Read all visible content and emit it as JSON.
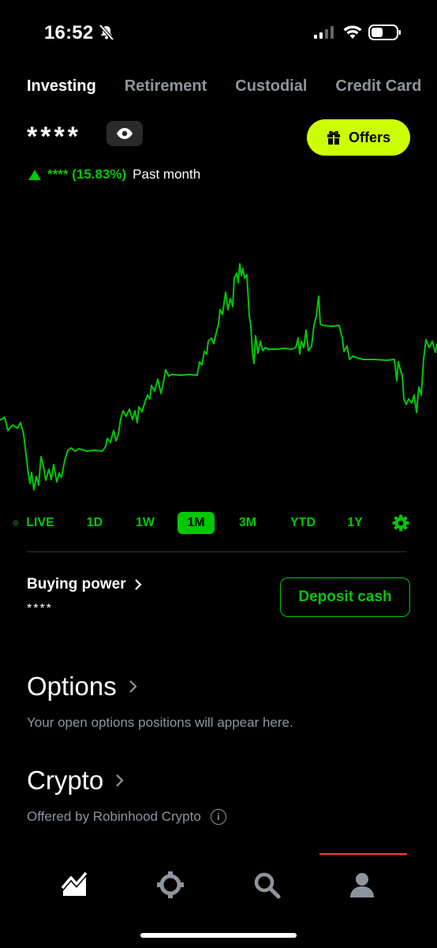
{
  "status_bar": {
    "time": "16:52"
  },
  "tabs": [
    {
      "label": "Investing",
      "active": true
    },
    {
      "label": "Retirement",
      "active": false
    },
    {
      "label": "Custodial",
      "active": false
    },
    {
      "label": "Credit Card",
      "active": false
    }
  ],
  "balance": {
    "value": "****",
    "eye_icon": "eye-icon"
  },
  "offers": {
    "label": "Offers",
    "icon": "gift-icon"
  },
  "change": {
    "value": "**** (15.83%)",
    "period": "Past month",
    "direction": "up"
  },
  "chart": {
    "color": "#00c805"
  },
  "ranges": [
    {
      "label": "LIVE",
      "selected": false
    },
    {
      "label": "1D",
      "selected": false
    },
    {
      "label": "1W",
      "selected": false
    },
    {
      "label": "1M",
      "selected": true
    },
    {
      "label": "3M",
      "selected": false
    },
    {
      "label": "YTD",
      "selected": false
    },
    {
      "label": "1Y",
      "selected": false
    }
  ],
  "buying_power": {
    "label": "Buying power",
    "value": "****",
    "deposit_label": "Deposit cash"
  },
  "options": {
    "title": "Options",
    "subtitle": "Your open options positions will appear here."
  },
  "crypto": {
    "title": "Crypto",
    "subtitle": "Offered by Robinhood Crypto"
  },
  "nav": [
    "investing-icon",
    "crypto-icon",
    "search-icon",
    "account-icon"
  ],
  "colors": {
    "accent": "#00c805",
    "offers_bg": "#ccff00",
    "muted": "#8d959d"
  }
}
